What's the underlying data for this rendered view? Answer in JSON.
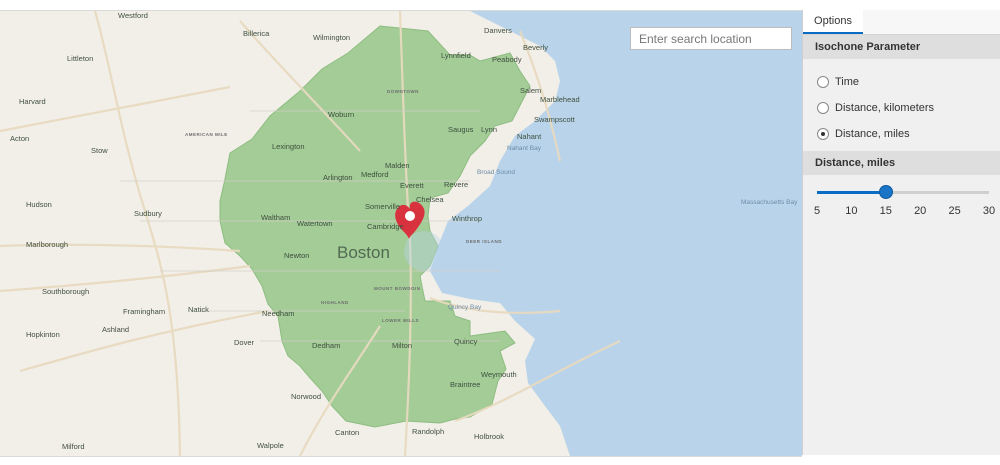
{
  "search": {
    "placeholder": "Enter search location"
  },
  "panel": {
    "tab": "Options",
    "parameter": {
      "title": "Isochone Parameter",
      "options": [
        {
          "label": "Time",
          "checked": false
        },
        {
          "label": "Distance, kilometers",
          "checked": false
        },
        {
          "label": "Distance, miles",
          "checked": true
        }
      ]
    },
    "distance": {
      "title": "Distance, miles",
      "ticks": [
        "5",
        "10",
        "15",
        "20",
        "25",
        "30"
      ],
      "min": 5,
      "max": 30,
      "value": 15
    }
  },
  "map": {
    "labels": [
      "Westford",
      "Billerica",
      "Wilmington",
      "Danvers",
      "Beverly",
      "Littleton",
      "Lynnfield",
      "Peabody",
      "Salem",
      "Marblehead",
      "Swampscott",
      "Lynn",
      "Saugus",
      "Woburn",
      "Lexington",
      "Malden",
      "Medford",
      "Arlington",
      "Everett",
      "Revere",
      "Chelsea",
      "Somerville",
      "Cambridge",
      "Waltham",
      "Watertown",
      "Boston",
      "Newton",
      "Winthrop",
      "Acton",
      "Hudson",
      "Sudbury",
      "Marlborough",
      "Southborough",
      "Framingham",
      "Natick",
      "Needham",
      "Dedham",
      "Milton",
      "Quincy",
      "Weymouth",
      "Braintree",
      "Norwood",
      "Canton",
      "Randolph",
      "Holbrook",
      "Walpole",
      "Milford",
      "Hopkinton",
      "Ashland",
      "Dover",
      "Harvard",
      "Stow",
      "Nahant Bay",
      "Quincy Bay",
      "Broad Sound",
      "Massachusetts Bay",
      "DOWNTOWN",
      "HIGHLAND",
      "MOUNT BOWDOIN",
      "LOWER MILLS",
      "AMERICAN MILE",
      "DEER ISLAND",
      "Nahant"
    ]
  },
  "colors": {
    "accent": "#0b6cc5",
    "isochrone": "#9cc98f",
    "water": "#b9d4ea",
    "pin": "#d7323d"
  },
  "icons": {
    "pin": "map-pin-icon"
  }
}
